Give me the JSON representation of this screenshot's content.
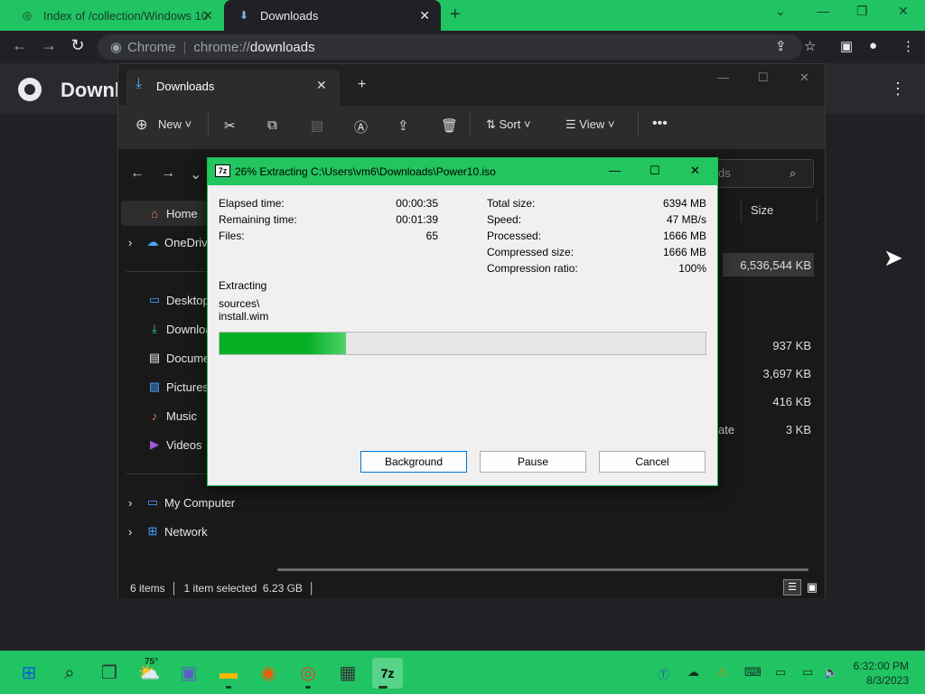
{
  "chrome": {
    "tabs": [
      {
        "label": "Index of /collection/Windows 10",
        "icon": "globe-icon"
      },
      {
        "label": "Downloads",
        "icon": "download-icon"
      }
    ],
    "omnibox": {
      "brand": "Chrome",
      "scheme": "chrome://",
      "host": "downloads"
    },
    "page_title": "Downl"
  },
  "explorer": {
    "tab_title": "Downloads",
    "ribbon": {
      "new": "New",
      "sort": "Sort",
      "view": "View"
    },
    "search_placeholder": "ds",
    "nav": {
      "home": "Home",
      "onedrive": "OneDriv",
      "desktop": "Desktop",
      "downloads": "Downloa",
      "documents": "Docume",
      "pictures": "Pictures",
      "music": "Music",
      "videos": "Videos",
      "my_computer": "My Computer",
      "network": "Network"
    },
    "column_size": "Size",
    "sizes": [
      "6,536,544 KB",
      "937 KB",
      "3,697 KB",
      "416 KB",
      "3 KB"
    ],
    "fragment_text": "ate",
    "status": {
      "items": "6 items",
      "selected": "1 item selected  6.23 GB"
    }
  },
  "zip": {
    "title": "26% Extracting C:\\Users\\vm6\\Downloads\\Power10.iso",
    "progress_fraction": 0.26,
    "left": [
      {
        "label": "Elapsed time:",
        "value": "00:00:35"
      },
      {
        "label": "Remaining time:",
        "value": "00:01:39"
      },
      {
        "label": "Files:",
        "value": "65"
      }
    ],
    "right": [
      {
        "label": "Total size:",
        "value": "6394 MB"
      },
      {
        "label": "Speed:",
        "value": "47 MB/s"
      },
      {
        "label": "Processed:",
        "value": "1666 MB"
      },
      {
        "label": "Compressed size:",
        "value": "1666 MB"
      },
      {
        "label": "Compression ratio:",
        "value": "100%"
      }
    ],
    "action": "Extracting",
    "path_line1": "sources\\",
    "path_line2": "install.wim",
    "buttons": {
      "background": "Background",
      "pause": "Pause",
      "cancel": "Cancel"
    }
  },
  "taskbar": {
    "weather": "75°",
    "time": "6:32:00 PM",
    "date": "8/3/2023"
  },
  "colors": {
    "accent": "#21c463",
    "progress": "#06b025",
    "dark": "#202124"
  }
}
